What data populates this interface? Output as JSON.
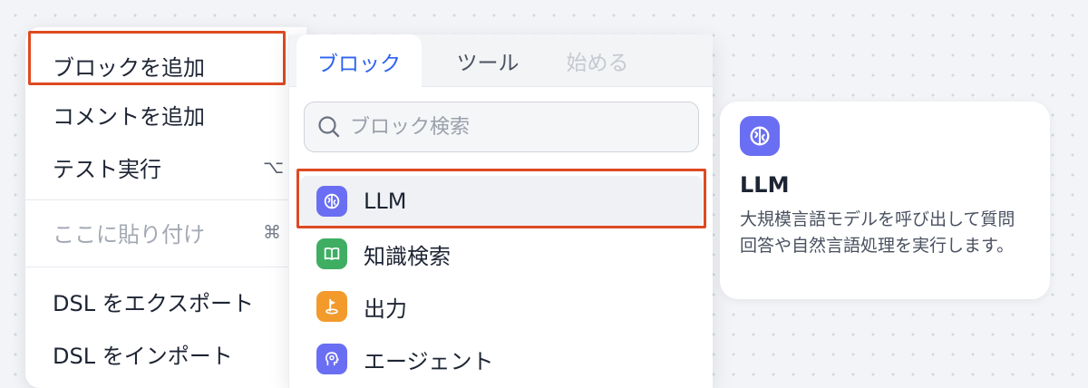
{
  "context_menu": {
    "items": [
      {
        "label": "ブロックを追加",
        "shortcut": ""
      },
      {
        "label": "コメントを追加",
        "shortcut": ""
      },
      {
        "label": "テスト実行",
        "shortcut": "⌥"
      },
      {
        "label": "ここに貼り付け",
        "shortcut": "⌘",
        "disabled": true
      },
      {
        "label": "DSL をエクスポート",
        "shortcut": ""
      },
      {
        "label": "DSL をインポート",
        "shortcut": ""
      }
    ]
  },
  "picker": {
    "tabs": [
      {
        "label": "ブロック",
        "state": "active"
      },
      {
        "label": "ツール",
        "state": "normal"
      },
      {
        "label": "始める",
        "state": "disabled"
      }
    ],
    "search": {
      "placeholder": "ブロック検索",
      "value": ""
    },
    "blocks": [
      {
        "label": "LLM",
        "icon": "llm-brain-icon",
        "color": "#6a6ef2"
      },
      {
        "label": "知識検索",
        "icon": "book-icon",
        "color": "#3fae63"
      },
      {
        "label": "出力",
        "icon": "flag-icon",
        "color": "#f39a2c"
      },
      {
        "label": "エージェント",
        "icon": "agent-head-icon",
        "color": "#6a6ef2"
      }
    ]
  },
  "info_card": {
    "icon": "llm-brain-icon",
    "icon_color": "#6a6ef2",
    "title": "LLM",
    "description": "大規模言語モデルを呼び出して質問回答や自然言語処理を実行します。"
  },
  "colors": {
    "accent": "#2d63f0",
    "highlight_border": "#de4a22"
  }
}
